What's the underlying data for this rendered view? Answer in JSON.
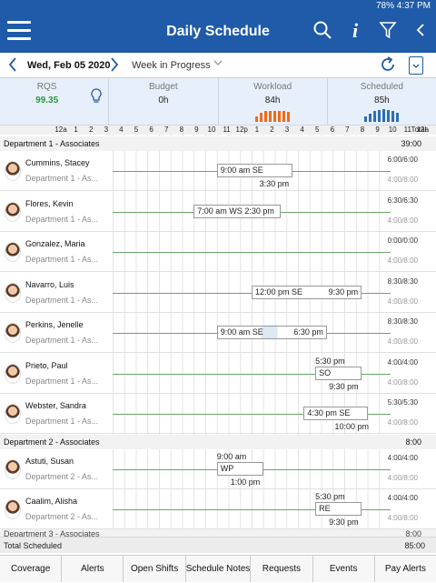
{
  "status": {
    "text": "78% 4:37 PM"
  },
  "appbar": {
    "title": "Daily Schedule",
    "info": "i"
  },
  "datebar": {
    "date": "Wed, Feb 05 2020",
    "status": "Week in Progress"
  },
  "metrics": [
    {
      "label": "RQS",
      "value": "99.35"
    },
    {
      "label": "Budget",
      "value": "0h"
    },
    {
      "label": "Workload",
      "value": "84h",
      "bar_color": "#f06a1a"
    },
    {
      "label": "Scheduled",
      "value": "85h",
      "bar_color": "#2c6fb8"
    }
  ],
  "hours": [
    "12a",
    "1",
    "2",
    "3",
    "4",
    "5",
    "6",
    "7",
    "8",
    "9",
    "10",
    "11",
    "12p",
    "1",
    "2",
    "3",
    "4",
    "5",
    "6",
    "7",
    "8",
    "9",
    "10",
    "11",
    "12a"
  ],
  "hours_total": "Total",
  "departments": [
    {
      "name": "Department 1 - Associates",
      "total": "39:00"
    },
    {
      "name": "Department 2 - Associates",
      "total": "8:00"
    }
  ],
  "employees": [
    {
      "name": "Cummins, Stacey",
      "dept": "Department 1 - As...",
      "start": "9:00 am",
      "code": "SE",
      "end": "3:30 pm",
      "hrs1": "6:00/6:00",
      "hrs2": "4:00/8:00"
    },
    {
      "name": "Flores, Kevin",
      "dept": "Department 1 - As...",
      "start": "7:00 am",
      "code": "WS",
      "end": "2:30 pm",
      "hrs1": "6:30/6:30",
      "hrs2": "4:00/8:00"
    },
    {
      "name": "Gonzalez, Maria",
      "dept": "Department 1 - As...",
      "hrs1": "0:00/0:00",
      "hrs2": "4:00/8:00"
    },
    {
      "name": "Navarro, Luis",
      "dept": "Department 1 - As...",
      "start": "12:00 pm",
      "code": "SE",
      "end": "9:30 pm",
      "hrs1": "8:30/8:30",
      "hrs2": "4:00/8:00"
    },
    {
      "name": "Perkins, Jenelle",
      "dept": "Department 1 - As...",
      "start": "9:00 am",
      "code": "SE",
      "end": "6:30 pm",
      "hrs1": "8:30/8:30",
      "hrs2": "4:00/8:00"
    },
    {
      "name": "Prieto, Paul",
      "dept": "Department 1 - As...",
      "start": "5:30 pm",
      "code": "SO",
      "end": "9:30 pm",
      "hrs1": "4:00/4:00",
      "hrs2": "4:00/8:00"
    },
    {
      "name": "Webster, Sandra",
      "dept": "Department 1 - As...",
      "start": "4:30 pm",
      "code": "SE",
      "end": "10:00 pm",
      "hrs1": "5:30/5:30",
      "hrs2": "4:00/8:00"
    },
    {
      "name": "Astuti, Susan",
      "dept": "Department 2 - As...",
      "start": "9:00 am",
      "code": "WP",
      "end": "1:00 pm",
      "hrs1": "4:00/4:00",
      "hrs2": "4:00/8:00"
    },
    {
      "name": "Caalim, Alisha",
      "dept": "Department 2 - As...",
      "start": "5:30 pm",
      "code": "RE",
      "end": "9:30 pm",
      "hrs1": "4:00/4:00",
      "hrs2": "4:00/8:00"
    }
  ],
  "partial_row": {
    "name": "Department 3 - Associates",
    "total": "8:00"
  },
  "total_row": {
    "label": "Total Scheduled",
    "value": "85:00"
  },
  "tabs": [
    "Coverage",
    "Alerts",
    "Open Shifts",
    "Schedule Notes",
    "Requests",
    "Events",
    "Pay Alerts"
  ]
}
